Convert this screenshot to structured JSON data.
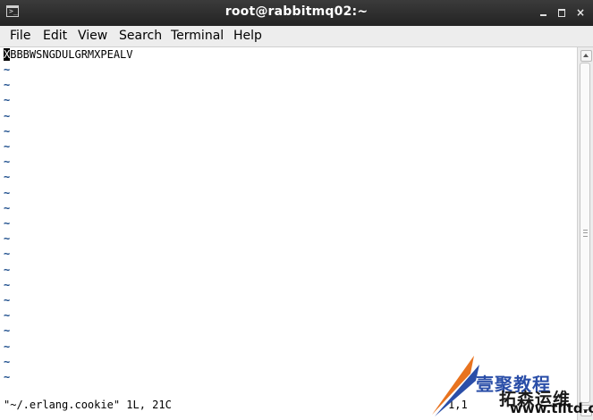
{
  "window": {
    "title": "root@rabbitmq02:~",
    "controls": {
      "minimize": "minimize",
      "maximize": "maximize",
      "close": "×"
    }
  },
  "menubar": {
    "items": [
      "File",
      "Edit",
      "View",
      "Search",
      "Terminal",
      "Help"
    ]
  },
  "editor": {
    "first_line_cursor": "X",
    "first_line_rest": "BBBWSNGDULGRMXPEALV",
    "tilde": "~",
    "empty_line_count": 21,
    "status_left": "\"~/.erlang.cookie\" 1L, 21C",
    "status_right": "1,1"
  },
  "watermark": {
    "line1": "壹聚教程",
    "line2": "拓森运维",
    "url": "www.tlltd.cn"
  },
  "colors": {
    "titlebar": "#2e2e2e",
    "menubar": "#ededed",
    "terminal_bg": "#ffffff",
    "tilde": "#1c4d8c",
    "watermark_blue": "#2a4ea8",
    "watermark_orange": "#e8731f"
  }
}
